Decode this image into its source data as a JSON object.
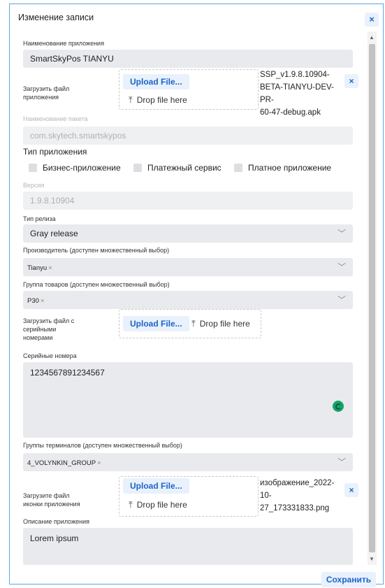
{
  "dialog": {
    "title": "Изменение записи",
    "close_symbol": "×",
    "save_label": "Сохранить"
  },
  "app_name": {
    "label": "Наименование приложения",
    "value": "SmartSkyPos TIANYU"
  },
  "app_file": {
    "label_line1": "Загрузить файл",
    "label_line2": "приложения",
    "upload_label": "Upload File...",
    "drop_label": "Drop file here",
    "filename_line1": "SSP_v1.9.8.10904-",
    "filename_line2": "BETA-TIANYU-DEV-PR-",
    "filename_line3": "60-47-debug.apk",
    "remove_symbol": "×"
  },
  "package_name": {
    "label": "Наименование пакета",
    "value": "com.skytech.smartskypos"
  },
  "app_type": {
    "title": "Тип приложения",
    "options": [
      "Бизнес-приложение",
      "Платежный сервис",
      "Платное приложение"
    ]
  },
  "version": {
    "label": "Версия",
    "value": "1.9.8.10904"
  },
  "release_type": {
    "label": "Тип релиза",
    "value": "Gray release"
  },
  "manufacturer": {
    "label": "Производитель (доступен множественный выбор)",
    "chip": "Tianyu"
  },
  "product_group": {
    "label": "Группа товаров (доступен множественный выбор)",
    "chip": "P30"
  },
  "serials_file": {
    "label_line1": "Загрузить файл с",
    "label_line2": "серийными",
    "label_line3": "номерами",
    "upload_label": "Upload File...",
    "drop_label": "Drop file here"
  },
  "serials": {
    "label": "Серийные номера",
    "value": "1234567891234567"
  },
  "terminal_groups": {
    "label": "Группы терминалов (доступен множественный выбор)",
    "chip": "4_VOLYNKIN_GROUP"
  },
  "icon_file": {
    "label_line1": "Загрузите файл",
    "label_line2": "иконки приложения",
    "upload_label": "Upload File...",
    "drop_label": "Drop file here",
    "filename_line1": "изображение_2022-10-",
    "filename_line2": "27_173331833.png",
    "remove_symbol": "×"
  },
  "description": {
    "label": "Описание приложения",
    "value": "Lorem ipsum"
  },
  "icons": {
    "chevron": "chevron-down-icon",
    "upload_arrow": "upload-icon",
    "chip_remove": "close-icon",
    "scroll_up": "arrow-up-icon",
    "scroll_down": "arrow-down-icon",
    "grammar": "grammarly-icon"
  },
  "colors": {
    "accent": "#1d64c8",
    "dialog_border": "#5aa6e6",
    "field_bg": "#e8eaed",
    "button_bg": "#e8f1fc"
  }
}
